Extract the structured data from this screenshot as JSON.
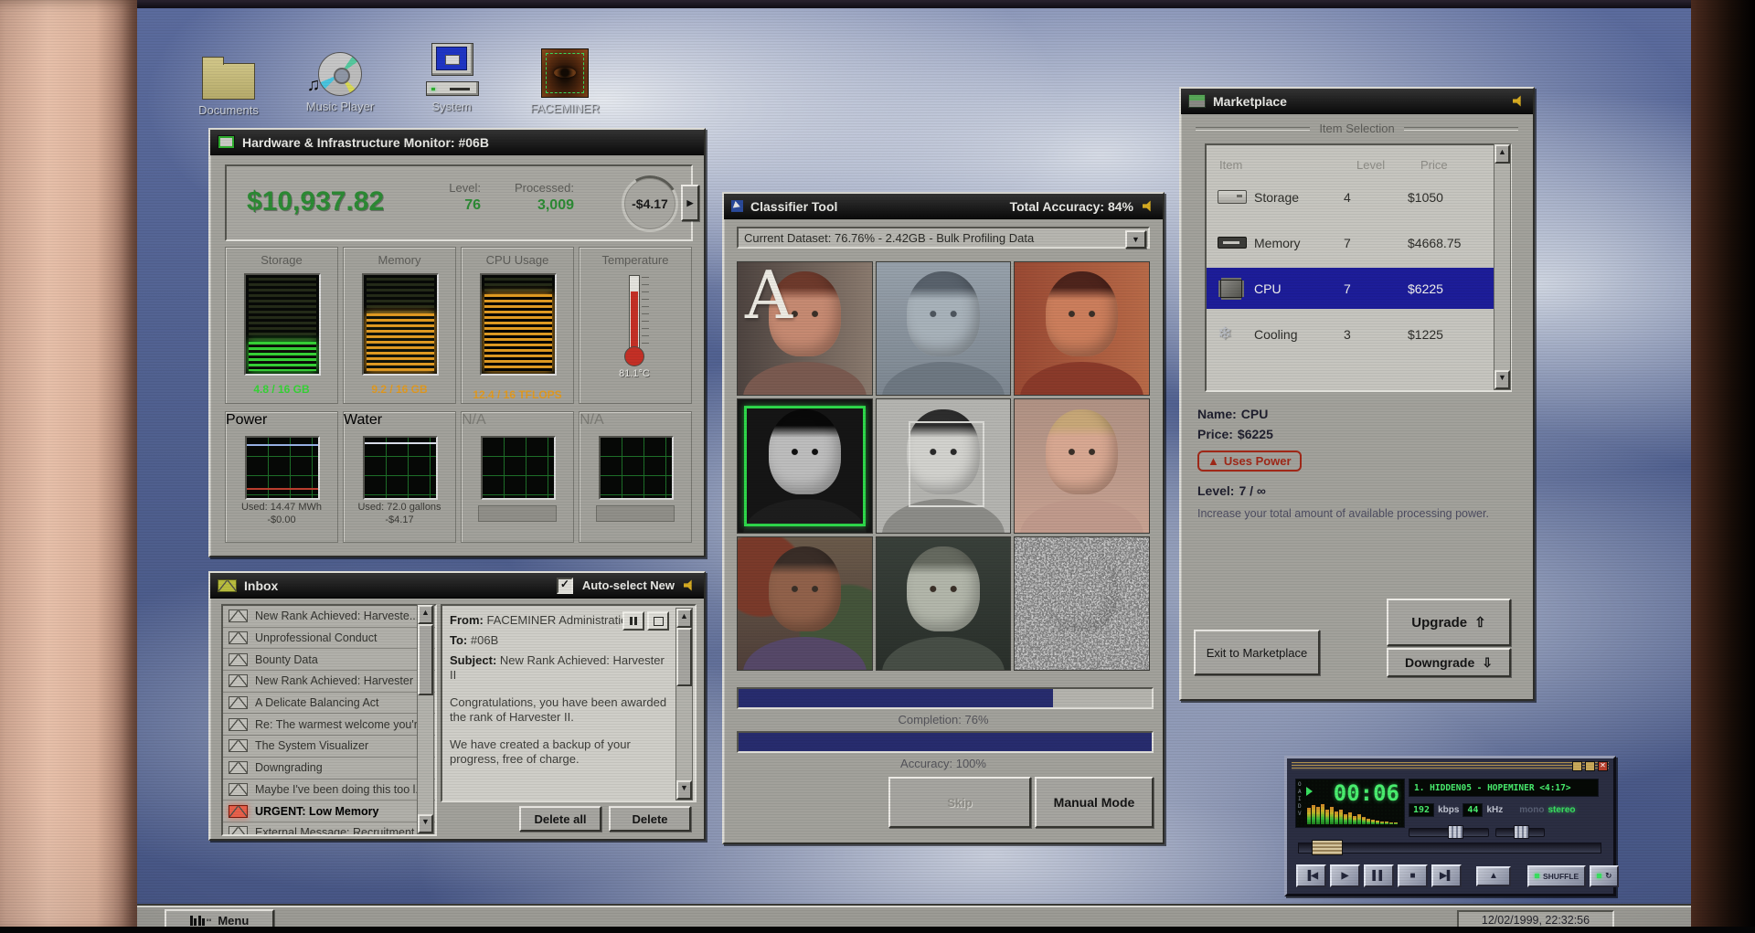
{
  "desktop": {
    "icons": [
      {
        "label": "Documents"
      },
      {
        "label": "Music Player"
      },
      {
        "label": "System"
      },
      {
        "label": "FACEMINER"
      }
    ]
  },
  "hardware_monitor": {
    "title": "Hardware & Infrastructure Monitor: #06B",
    "balance": "$10,937.82",
    "level_label": "Level:",
    "level": "76",
    "processed_label": "Processed:",
    "processed": "3,009",
    "rate": "-$4.17",
    "gauges": [
      {
        "label": "Storage",
        "value": "4.8 / 16 GB",
        "percent": 30,
        "color": "#36d336"
      },
      {
        "label": "Memory",
        "value": "9.2 / 16 GB",
        "percent": 58,
        "color": "#e09a22"
      },
      {
        "label": "CPU Usage",
        "value": "12.4 / 16 TFLOPS",
        "percent": 78,
        "color": "#e09a22"
      },
      {
        "label": "Temperature",
        "value": "81.1°C",
        "percent": 79
      }
    ],
    "meters": [
      {
        "label": "Power",
        "used": "Used: 14.47 MWh",
        "cost": "-$0.00"
      },
      {
        "label": "Water",
        "used": "Used: 72.0 gallons",
        "cost": "-$4.17"
      },
      {
        "label": "N/A"
      },
      {
        "label": "N/A"
      }
    ]
  },
  "inbox": {
    "title": "Inbox",
    "autoselect_label": "Auto-select New",
    "messages": [
      {
        "title": "New Rank Achieved: Harveste..."
      },
      {
        "title": "Unprofessional Conduct"
      },
      {
        "title": "Bounty Data"
      },
      {
        "title": "New Rank Achieved: Harvester I"
      },
      {
        "title": "A Delicate Balancing Act"
      },
      {
        "title": "Re: The warmest welcome you'r..."
      },
      {
        "title": "The System Visualizer"
      },
      {
        "title": "Downgrading"
      },
      {
        "title": "Maybe I've been doing this too l..."
      },
      {
        "title": "URGENT: Low Memory"
      },
      {
        "title": "External Message: Recruitment"
      }
    ],
    "mail": {
      "from_label": "From:",
      "from": "FACEMINER Administration",
      "to_label": "To:",
      "to": "#06B",
      "subject_label": "Subject:",
      "subject": "New Rank Achieved: Harvester II",
      "body_1": "Congratulations, you have been awarded the rank of Harvester II.",
      "body_2": "We have created a backup of your progress, free of charge."
    },
    "delete_all_label": "Delete all",
    "delete_label": "Delete"
  },
  "classifier": {
    "title": "Classifier Tool",
    "total_accuracy": "Total Accuracy: 84%",
    "dataset": "Current Dataset: 76.76% - 2.42GB - Bulk Profiling Data",
    "overlay_letter": "A",
    "completion_label": "Completion: 76%",
    "completion_percent": 76,
    "accuracy_label": "Accuracy: 100%",
    "accuracy_percent": 100,
    "skip_label": "Skip",
    "manual_label": "Manual Mode"
  },
  "marketplace": {
    "title": "Marketplace",
    "group_label": "Item Selection",
    "headers": {
      "item": "Item",
      "level": "Level",
      "price": "Price"
    },
    "items": [
      {
        "name": "Storage",
        "level": "4",
        "price": "$1050"
      },
      {
        "name": "Memory",
        "level": "7",
        "price": "$4668.75"
      },
      {
        "name": "CPU",
        "level": "7",
        "price": "$6225"
      },
      {
        "name": "Cooling",
        "level": "3",
        "price": "$1225"
      }
    ],
    "detail": {
      "name_label": "Name:",
      "name": "CPU",
      "price_label": "Price:",
      "price": "$6225",
      "warning": "Uses Power",
      "level_label": "Level:",
      "level": "7 / ∞",
      "description": "Increase your total amount of available processing power."
    },
    "upgrade_label": "Upgrade",
    "downgrade_label": "Downgrade",
    "exit_label": "Exit to Marketplace"
  },
  "player": {
    "time": "00:06",
    "track": "1. HIDDEN05 - HOPEMINER <4:17>",
    "bitrate": "192",
    "bitrate_unit": "kbps",
    "samplerate": "44",
    "samplerate_unit": "kHz",
    "mono_label": "mono",
    "stereo_label": "stereo",
    "shuffle_label": "SHUFFLE",
    "clutterbar": "OAIDV"
  },
  "taskbar": {
    "menu_label": "Menu",
    "clock": "12/02/1999, 22:32:56"
  }
}
